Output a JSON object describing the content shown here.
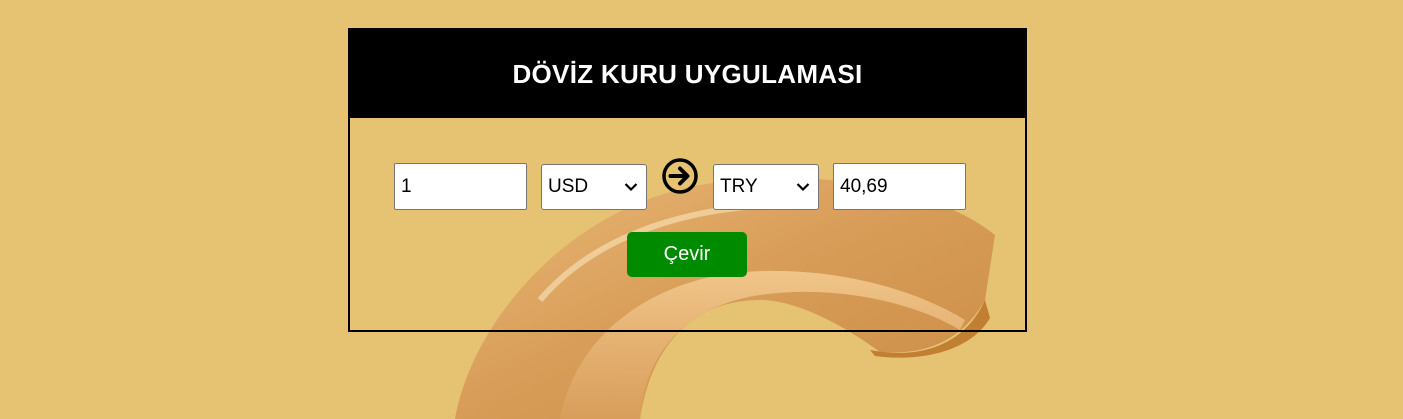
{
  "app": {
    "title": "DÖVİZ KURU UYGULAMASI"
  },
  "converter": {
    "amount_value": "1",
    "from_currency": "USD",
    "to_currency": "TRY",
    "result_value": "40,69",
    "convert_label": "Çevir",
    "arrow_icon": "arrow-right-circle-icon"
  },
  "colors": {
    "background": "#e6c273",
    "header_bg": "#000000",
    "header_text": "#ffffff",
    "convert_button": "#008a00"
  }
}
